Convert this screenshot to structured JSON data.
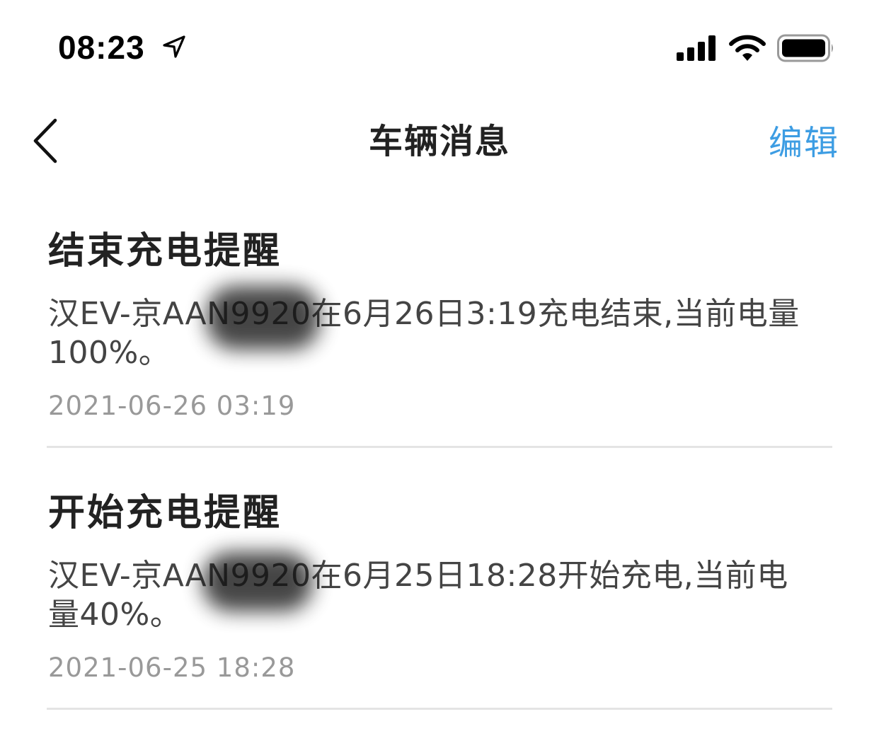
{
  "status_bar": {
    "time": "08:23",
    "icons": [
      "location-arrow-icon",
      "signal-icon",
      "wifi-icon",
      "battery-icon"
    ]
  },
  "nav": {
    "back_icon": "chevron-left-icon",
    "title": "车辆消息",
    "edit_label": "编辑",
    "accent_color": "#3d9de3"
  },
  "messages": [
    {
      "title": "结束充电提醒",
      "body": "汉EV-京AAN9920在6月26日3:19充电结束,当前电量100%。",
      "time": "2021-06-26 03:19"
    },
    {
      "title": "开始充电提醒",
      "body": "汉EV-京AAN9920在6月25日18:28开始充电,当前电量40%。",
      "time": "2021-06-25 18:28"
    }
  ]
}
